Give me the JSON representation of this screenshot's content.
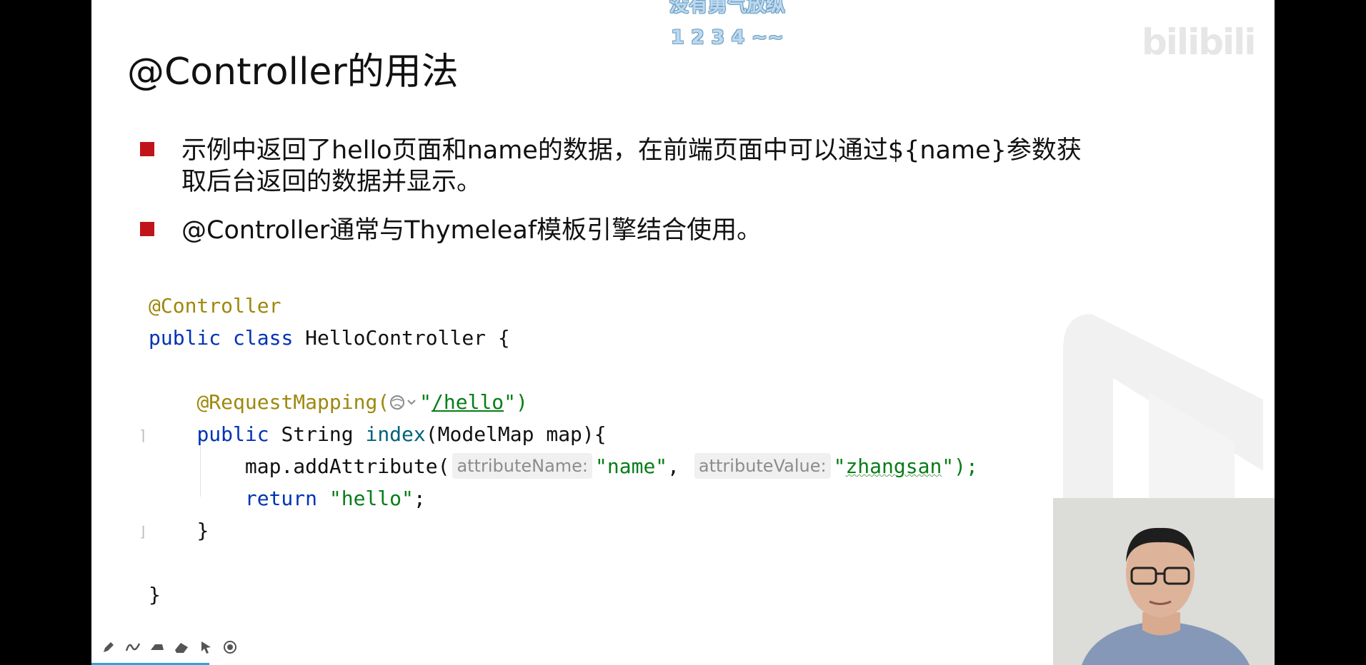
{
  "slide": {
    "title": "@Controller的用法",
    "bullets": [
      "示例中返回了hello页面和name的数据，在前端页面中可以通过${name}参数获取后台返回的数据并显示。",
      "@Controller通常与Thymeleaf模板引擎结合使用。"
    ]
  },
  "danmaku": {
    "line1": "没有勇气放纵",
    "line2": "1 2 3 4 ~~"
  },
  "watermark": "bilibili",
  "code": {
    "l1_annotation": "@Controller",
    "l2_public": "public",
    "l2_class": "class",
    "l2_name": "HelloController {",
    "l4_annotation": "@RequestMapping(",
    "l4_q1": "\"",
    "l4_path": "/hello",
    "l4_tail": "\")",
    "l5_public": "public",
    "l5_type": "String",
    "l5_method": "index",
    "l5_params": "(ModelMap map){",
    "l6_call": "map.addAttribute(",
    "l6_hint1": "attributeName:",
    "l6_arg1": "\"name\"",
    "l6_comma": ",",
    "l6_hint2": "attributeValue:",
    "l6_q": "\"",
    "l6_arg2": "zhangsan",
    "l6_end": "\");",
    "l7_return": "return",
    "l7_value": "\"hello\"",
    "l7_semi": ";",
    "l8_brace": "}",
    "l10_brace": "}"
  },
  "toolbar": {
    "icons": [
      "pencil-icon",
      "curve-icon",
      "highlighter-icon",
      "eraser-icon",
      "pointer-icon",
      "record-icon"
    ]
  },
  "colors": {
    "bullet": "#c0141a",
    "annotation": "#9e880d",
    "keyword": "#0033b3",
    "string": "#067d17",
    "progress": "#2da3e0"
  }
}
